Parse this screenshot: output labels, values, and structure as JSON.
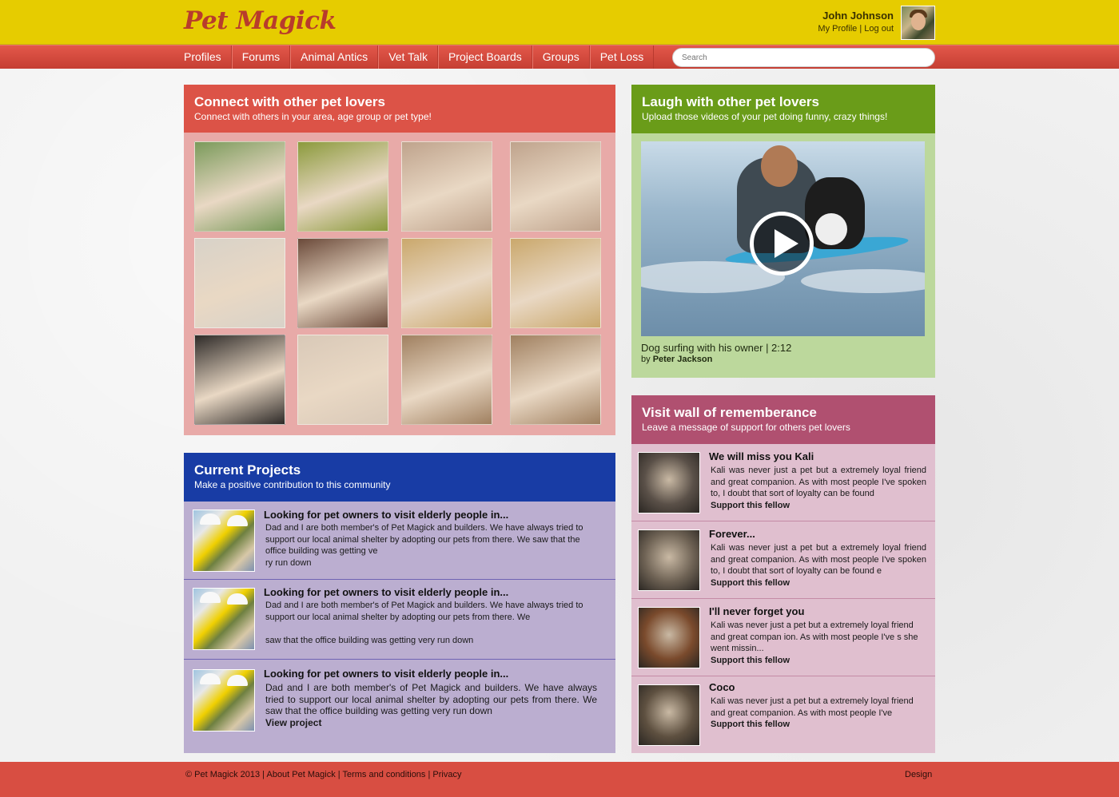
{
  "header": {
    "logo": "Pet Magick",
    "user_name": "John Johnson",
    "my_profile": "My Profile",
    "logout": "Log out",
    "separator": "|"
  },
  "nav": {
    "items": [
      "Profiles",
      "Forums",
      "Animal Antics",
      "Vet Talk",
      "Project Boards",
      "Groups",
      "Pet Loss"
    ],
    "search_placeholder": "Search"
  },
  "connect": {
    "title": "Connect with other pet lovers",
    "subtitle": "Connect with others in your area, age group or pet type!",
    "photo_colors": [
      "#7a9a5a",
      "#8b9a3c",
      "#bfa38c",
      "#bfa38c",
      "#d8d2c8",
      "#6b4a3a",
      "#caa86c",
      "#caa86c",
      "#2e2a28",
      "#d9c9b8",
      "#a08060",
      "#a08060"
    ]
  },
  "laugh": {
    "title": "Laugh with other pet lovers",
    "subtitle": "Upload those videos of your pet doing funny, crazy things!",
    "video_caption": "Dog surfing with his owner | 2:12",
    "by_prefix": "by",
    "by_author": "Peter Jackson"
  },
  "projects": {
    "title": "Current Projects",
    "subtitle": "Make a positive contribution to this community",
    "items": [
      {
        "title": "Looking for pet owners to visit elderly people in...",
        "text1": "Dad and I are both member's of Pet Magick and builders. We have always tried to support our local animal shelter by adopting our pets from there. We saw that the office building was getting ve",
        "text2": "ry run down"
      },
      {
        "title": "Looking for pet owners to visit elderly people in...",
        "text1": "Dad and I are both member's of Pet Magick and builders. We have always tried to support our local animal shelter by adopting our pets from there. We",
        "text2": "saw that the office building was getting very run down"
      },
      {
        "title": "Looking for pet owners to visit elderly people in...",
        "text1": "Dad and I are both member's of Pet Magick and builders. We have always tried to support our local animal shelter by adopting our pets from there. We saw that the office building was getting very run down",
        "link": "View project"
      }
    ]
  },
  "wall": {
    "title": "Visit wall of rememberance",
    "subtitle": "Leave a message of support for others pet lovers",
    "link_label": "Support this fellow",
    "items": [
      {
        "title": "We will miss you Kali",
        "text": "Kali was never just a pet but a extremely loyal friend and great companion. As with most people I've spoken to, I doubt that sort of loyalty can be found",
        "thumb_color": "#5a5048"
      },
      {
        "title": "Forever...",
        "text": "Kali was never just a pet but a extremely loyal friend and great companion. As with most people I've spoken to, I doubt that sort of loyalty can be found e",
        "thumb_color": "#6e6254"
      },
      {
        "title": "I'll never forget you",
        "text": "Kali was never just a pet but a extremely loyal friend and great compan ion. As with most people I've s she went missin...",
        "thumb_color": "#7a4a2c"
      },
      {
        "title": "Coco",
        "text": "Kali was never just a pet but a extremely loyal friend and great companion. As with most people I've",
        "thumb_color": "#5e5040"
      }
    ]
  },
  "footer": {
    "copyright": "© Pet Magick 2013",
    "about": "About Pet Magick",
    "terms": "Terms and conditions",
    "privacy": "Privacy",
    "separator": "|",
    "design": "Design"
  }
}
